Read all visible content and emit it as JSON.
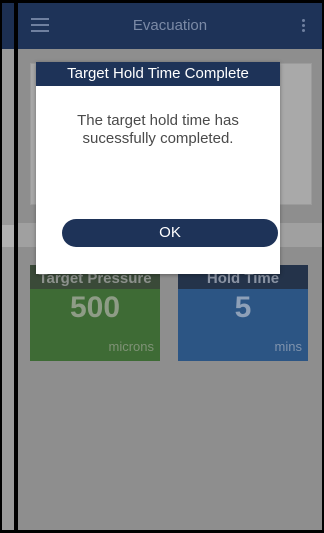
{
  "app": {
    "title": "Evacuation",
    "menu_icon": "hamburger-menu-icon",
    "more_icon": "vertical-dots-icon"
  },
  "tiles": [
    {
      "label": "Target Pressure",
      "value": "500",
      "unit": "microns",
      "color": "#3e6b35"
    },
    {
      "label": "Hold Time",
      "value": "5",
      "unit": "mins",
      "color": "#2c5584"
    }
  ],
  "dialog": {
    "title": "Target Hold Time Complete",
    "message": "The target hold time has sucessfully completed.",
    "ok_label": "OK",
    "accent": "#1e3358"
  }
}
